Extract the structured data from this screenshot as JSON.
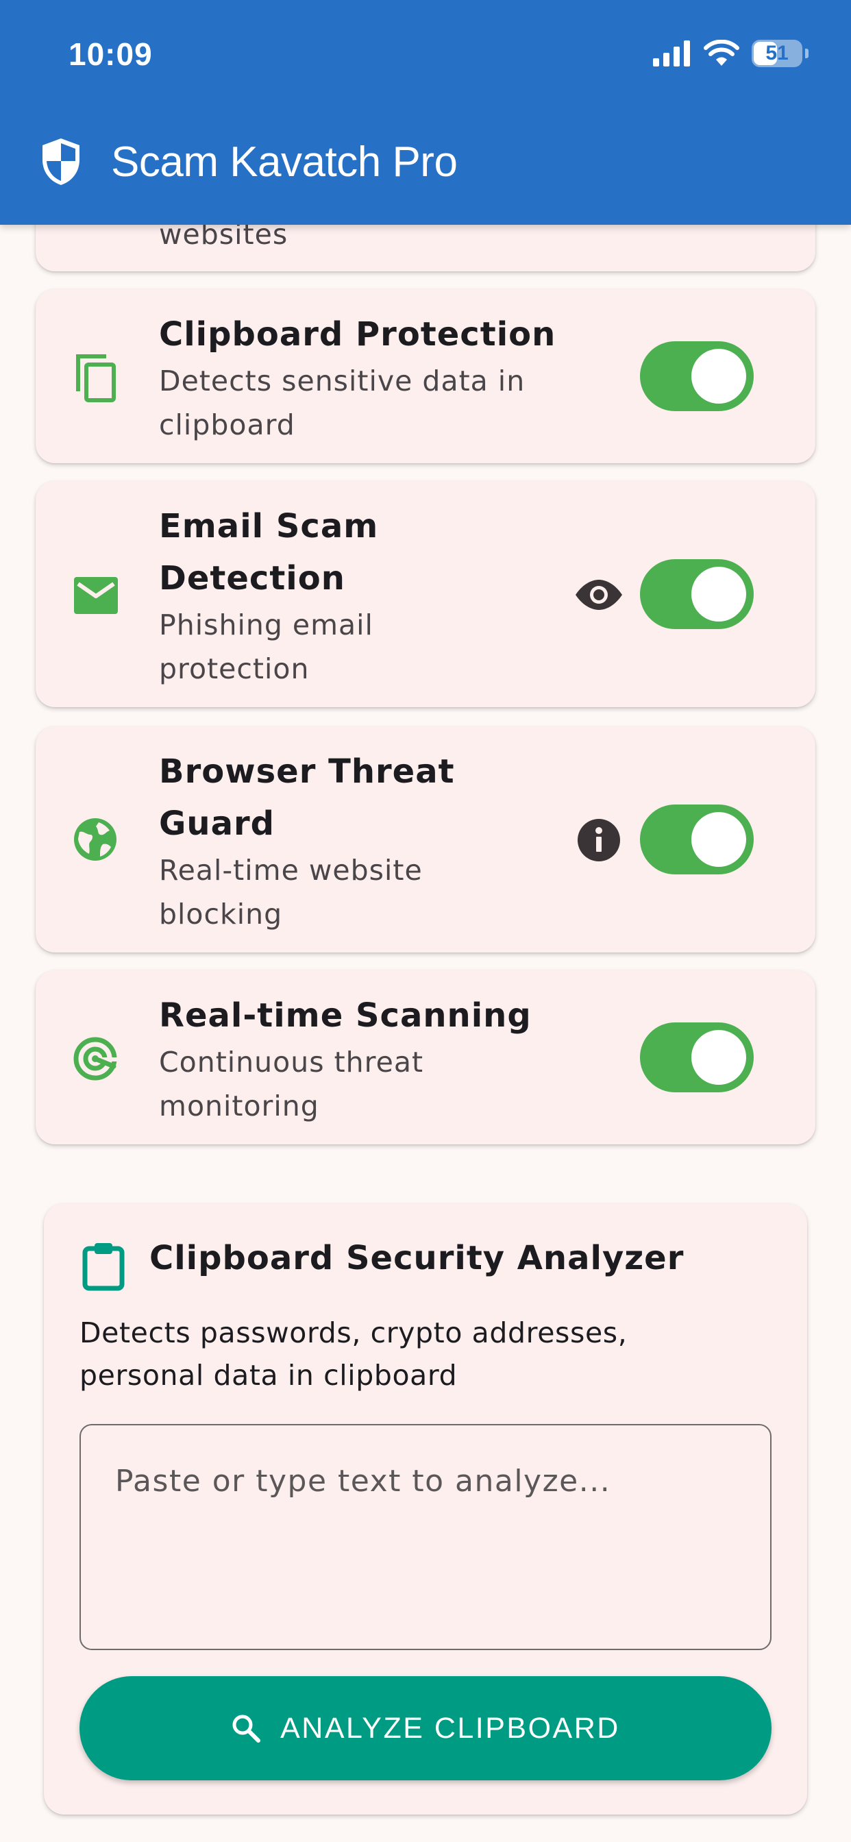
{
  "status_bar": {
    "time": "10:09",
    "battery_level": "51",
    "icons": [
      "signal-icon",
      "wifi-icon",
      "battery-icon"
    ]
  },
  "app_bar": {
    "title": "Scam Kavatch Pro",
    "icon": "shield-icon",
    "background_color": "#2670c5"
  },
  "partial_card": {
    "desc_tail": "websites"
  },
  "features": [
    {
      "id": "clipboard-protection",
      "icon": "copy-icon",
      "title": "Clipboard Protection",
      "desc_line1": "Detects sensitive data in",
      "desc_line2": "clipboard",
      "enabled": true
    },
    {
      "id": "email-scam-detection",
      "icon": "email-icon",
      "title_line1": "Email Scam",
      "title_line2": "Detection",
      "desc_line1": "Phishing email",
      "desc_line2": "protection",
      "aux_icon": "eye-icon",
      "enabled": true
    },
    {
      "id": "browser-threat-guard",
      "icon": "globe-icon",
      "title_line1": "Browser Threat",
      "title_line2": "Guard",
      "desc_line1": "Real-time website",
      "desc_line2": "blocking",
      "aux_icon": "info-icon",
      "enabled": true
    },
    {
      "id": "real-time-scanning",
      "icon": "radar-icon",
      "title": "Real-time Scanning",
      "desc_line1": "Continuous threat",
      "desc_line2": "monitoring",
      "enabled": true
    }
  ],
  "analyzer": {
    "icon": "clipboard-icon",
    "title": "Clipboard Security Analyzer",
    "desc_line1": "Detects passwords, crypto addresses,",
    "desc_line2": "personal data in clipboard",
    "input_value": "",
    "input_placeholder": "Paste or type text to analyze...",
    "button_icon": "search-icon",
    "button_label": "ANALYZE CLIPBOARD"
  },
  "colors": {
    "toggle_on": "#4caf50",
    "feature_icon": "#4caf50",
    "analyzer_accent": "#009b83",
    "card_background": "#fcefee",
    "page_background": "#fdf8f5"
  }
}
